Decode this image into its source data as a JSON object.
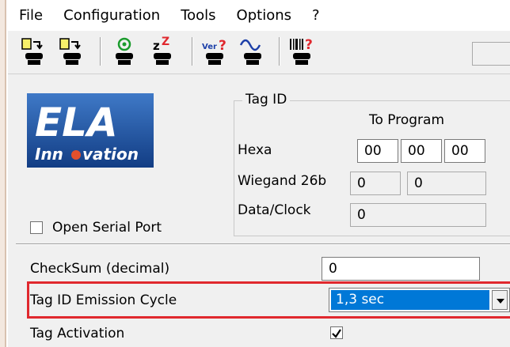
{
  "menu": {
    "items": [
      "File",
      "Configuration",
      "Tools",
      "Options",
      "?"
    ]
  },
  "toolbar": {
    "buttons": [
      {
        "icon": "read-config-icon"
      },
      {
        "icon": "write-config-icon"
      },
      {
        "icon": "wireless-icon"
      },
      {
        "icon": "sleep-icon"
      },
      {
        "icon": "version-query-icon"
      },
      {
        "icon": "signal-icon"
      },
      {
        "icon": "barcode-query-icon"
      }
    ]
  },
  "logo": {
    "text_main": "ELA",
    "text_sub_1": "Inn",
    "text_sub_2": "vation",
    "colors": {
      "background": "#1d4f9c",
      "accent": "#e2502b"
    }
  },
  "serial_port": {
    "label": "Open Serial Port",
    "checked": false
  },
  "tag_id": {
    "group_title": "Tag ID",
    "to_program": "To Program",
    "hexa_label": "Hexa",
    "hexa_values": [
      "00",
      "00",
      "00"
    ],
    "wiegand_label": "Wiegand 26b",
    "wiegand_values": [
      "0",
      "0"
    ],
    "dataclock_label": "Data/Clock",
    "dataclock_value": "0"
  },
  "checksum": {
    "label": "CheckSum (decimal)",
    "value": "0"
  },
  "emission_cycle": {
    "label": "Tag ID Emission Cycle",
    "value": "1,3 sec"
  },
  "tag_activation": {
    "label": "Tag Activation",
    "checked": true
  },
  "colors": {
    "highlight": "#e0282e",
    "selection": "#0078d7"
  }
}
